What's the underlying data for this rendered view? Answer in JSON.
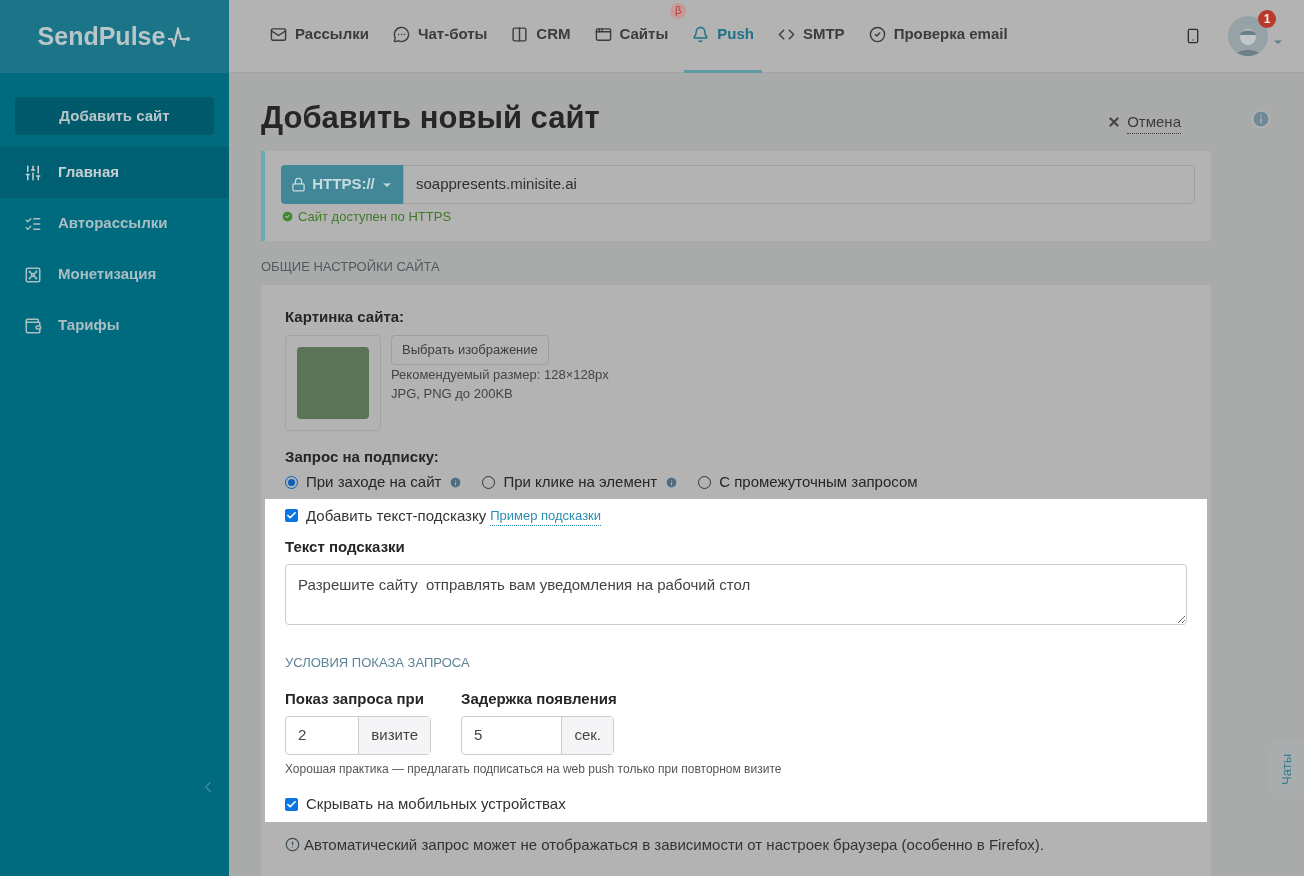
{
  "logo": "SendPulse",
  "nav": [
    {
      "label": "Рассылки",
      "selected": false
    },
    {
      "label": "Чат-боты",
      "selected": false
    },
    {
      "label": "CRM",
      "selected": false
    },
    {
      "label": "Сайты",
      "selected": false,
      "badge": "β"
    },
    {
      "label": "Push",
      "selected": true
    },
    {
      "label": "SMTP",
      "selected": false
    },
    {
      "label": "Проверка email",
      "selected": false
    }
  ],
  "avatar_badge": "1",
  "sidebar": {
    "add_button": "Добавить сайт",
    "items": [
      {
        "label": "Главная",
        "selected": true
      },
      {
        "label": "Авторассылки",
        "selected": false
      },
      {
        "label": "Монетизация",
        "selected": false
      },
      {
        "label": "Тарифы",
        "selected": false
      }
    ]
  },
  "page_title": "Добавить новый сайт",
  "cancel": "Отмена",
  "url": {
    "protocol": "HTTPS://",
    "value": "soappresents.minisite.ai",
    "status": "Сайт доступен по HTTPS"
  },
  "section_title": "ОБЩИЕ НАСТРОЙКИ САЙТА",
  "image": {
    "label": "Картинка сайта:",
    "button": "Выбрать изображение",
    "hints": [
      "Рекомендуемый размер: 128×128px",
      "JPG, PNG до 200KB"
    ]
  },
  "subscription": {
    "label": "Запрос на подписку:",
    "options": [
      {
        "label": "При заходе на сайт",
        "selected": true,
        "info": true
      },
      {
        "label": "При клике на элемент",
        "selected": false,
        "info": true
      },
      {
        "label": "С промежуточным запросом",
        "selected": false,
        "info": false
      }
    ]
  },
  "hint_checkbox": {
    "label": "Добавить текст-подсказку",
    "checked": true,
    "link": "Пример подсказки"
  },
  "hint_text": {
    "label": "Текст подсказки",
    "value": "Разрешите сайту  отправлять вам уведомления на рабочий стол"
  },
  "conditions_title": "УСЛОВИЯ ПОКАЗА ЗАПРОСА",
  "fields": [
    {
      "label": "Показ запроса при",
      "value": "2",
      "unit": "визите"
    },
    {
      "label": "Задержка появления",
      "value": "5",
      "unit": "сек."
    }
  ],
  "conditions_note": "Хорошая практика — предлагать подписаться на web push только при повторном визите",
  "hide_mobile": {
    "label": "Скрывать на мобильных устройствах",
    "checked": true
  },
  "warning": "Автоматический запрос может не отображаться в зависимости от настроек браузера (особенно в Firefox).",
  "chats_tab": "Чаты"
}
